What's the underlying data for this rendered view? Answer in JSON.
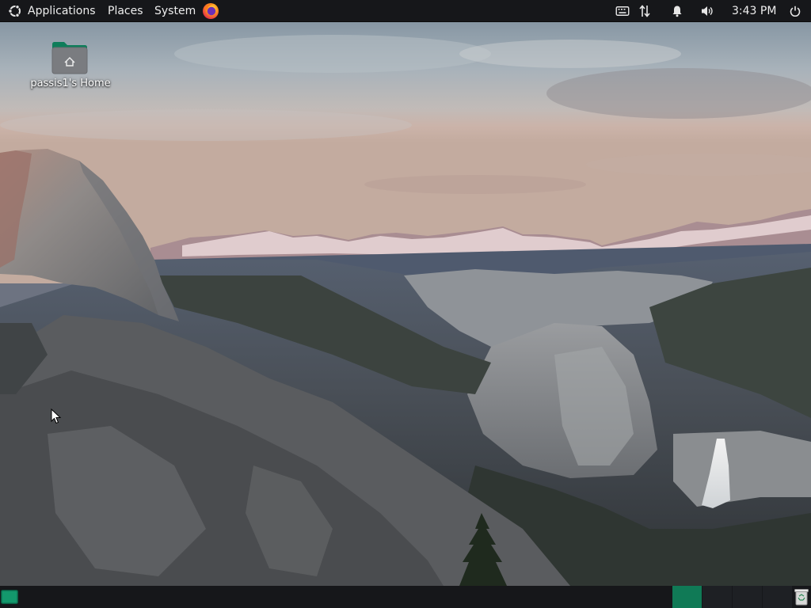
{
  "top_panel": {
    "menus": [
      {
        "label": "Applications",
        "icon": "ubuntu-logo-icon"
      },
      {
        "label": "Places"
      },
      {
        "label": "System"
      }
    ],
    "launchers": [
      {
        "icon": "firefox-icon"
      }
    ],
    "indicators": [
      {
        "icon": "keyboard-icon"
      },
      {
        "icon": "network-icon"
      },
      {
        "icon": "bell-icon"
      },
      {
        "icon": "volume-icon"
      }
    ],
    "clock": "3:43 PM",
    "power_icon": "power-icon"
  },
  "desktop": {
    "icons": [
      {
        "label": "passis1's Home",
        "icon": "home-folder-icon"
      }
    ],
    "wallpaper": "yosemite-valley-sunset"
  },
  "bottom_panel": {
    "show_desktop_icon": "show-desktop-icon",
    "workspaces": [
      {
        "active": true
      },
      {
        "active": false
      },
      {
        "active": false
      },
      {
        "active": false
      }
    ],
    "trash_icon": "trash-icon"
  },
  "colors": {
    "panel_bg": "#16171a",
    "accent": "#107a56",
    "text": "#eeeeee"
  }
}
